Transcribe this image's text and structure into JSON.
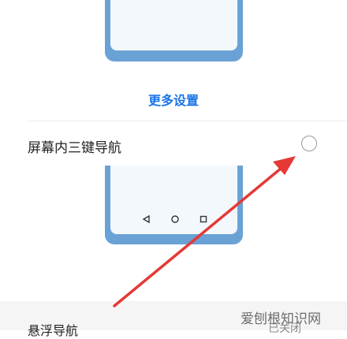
{
  "more_settings_link": "更多设置",
  "option": {
    "label": "屏幕内三键导航",
    "selected": false
  },
  "nav_icons": [
    "back-triangle-icon",
    "home-circle-icon",
    "recents-square-icon"
  ],
  "next_section": {
    "label": "悬浮导航",
    "status": "已关闭"
  },
  "watermark": "爱刨根知识网",
  "colors": {
    "phone_frame": "#6aa2d6",
    "phone_screen": "#f3f8fd",
    "link": "#1a73e8",
    "arrow": "#e53935"
  }
}
